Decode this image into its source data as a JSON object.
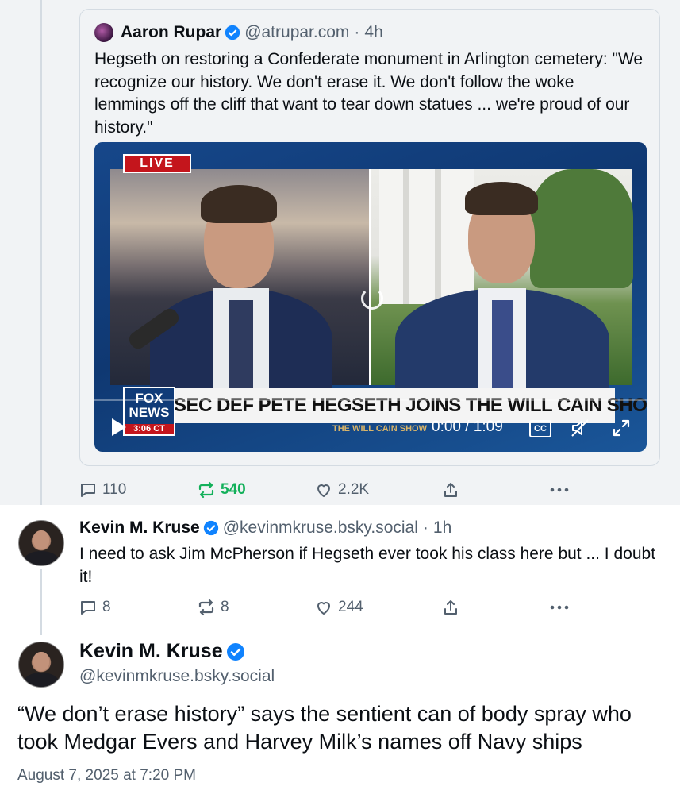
{
  "quoted_post": {
    "author_name": "Aaron Rupar",
    "author_handle": "@atrupar.com",
    "time_sep": "·",
    "age": "4h",
    "text": "Hegseth on restoring a Confederate monument in Arlington cemetery: \"We recognize our history. We don't erase it. We don't follow the woke lemmings off the cliff that want to tear down statues ... we're proud of our history.\"",
    "video": {
      "live_label": "LIVE",
      "network_logo": "FOX NEWS",
      "network_time": "3:06 CT",
      "chyron": "SEC DEF PETE HEGSETH JOINS THE WILL CAIN SHOW",
      "show_name": "THE WILL CAIN SHOW",
      "time_display": "0:00 / 1:09",
      "cc_label": "CC"
    },
    "actions": {
      "replies": "110",
      "reposts": "540",
      "likes": "2.2K"
    }
  },
  "reply_post": {
    "author_name": "Kevin M. Kruse",
    "author_handle": "@kevinmkruse.bsky.social",
    "time_sep": "·",
    "age": "1h",
    "text": "I need to ask Jim McPherson if Hegseth ever took his class here but ... I doubt it!",
    "actions": {
      "replies": "8",
      "reposts": "8",
      "likes": "244"
    }
  },
  "main_post": {
    "author_name": "Kevin M. Kruse",
    "author_handle": "@kevinmkruse.bsky.social",
    "text": "“We don’t erase history” says the sentient can of body spray who took Medgar Evers and Harvey Milk’s names off Navy ships",
    "date": "August 7, 2025 at 7:20 PM"
  },
  "colors": {
    "accent": "#1083fe",
    "repost_active": "#13b05a",
    "muted": "#53606e"
  }
}
